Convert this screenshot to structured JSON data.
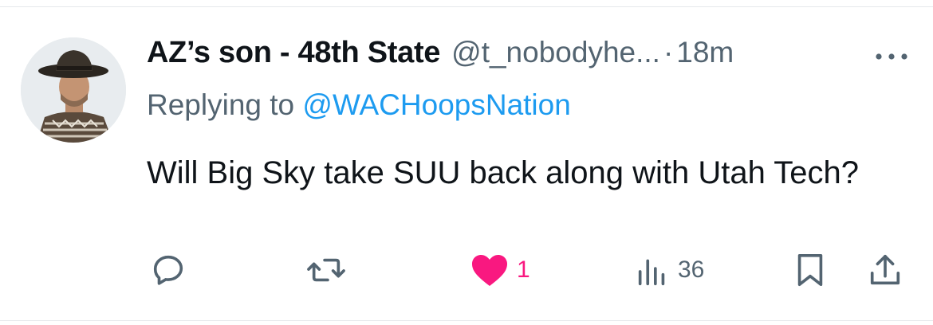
{
  "tweet": {
    "display_name": "AZ’s son - 48th State",
    "handle": "@t_nobodyhe...",
    "separator": "·",
    "time": "18m",
    "replying_prefix": "Replying to",
    "replying_to": "@WACHoopsNation",
    "text": "Will Big Sky take SUU back along with Utah Tech?"
  },
  "icons": {
    "avatar": "avatar-cowboy-photo",
    "more": "more-horizontal-icon",
    "reply": "reply-icon",
    "retweet": "retweet-icon",
    "like": "heart-icon",
    "views": "views-icon",
    "bookmark": "bookmark-icon",
    "share": "share-icon"
  },
  "actions": {
    "like_count": "1",
    "views_count": "36"
  },
  "colors": {
    "text": "#0f1419",
    "secondary": "#536471",
    "mention": "#1d9bf0",
    "like": "#f91880",
    "divider": "#e6e9ec"
  }
}
